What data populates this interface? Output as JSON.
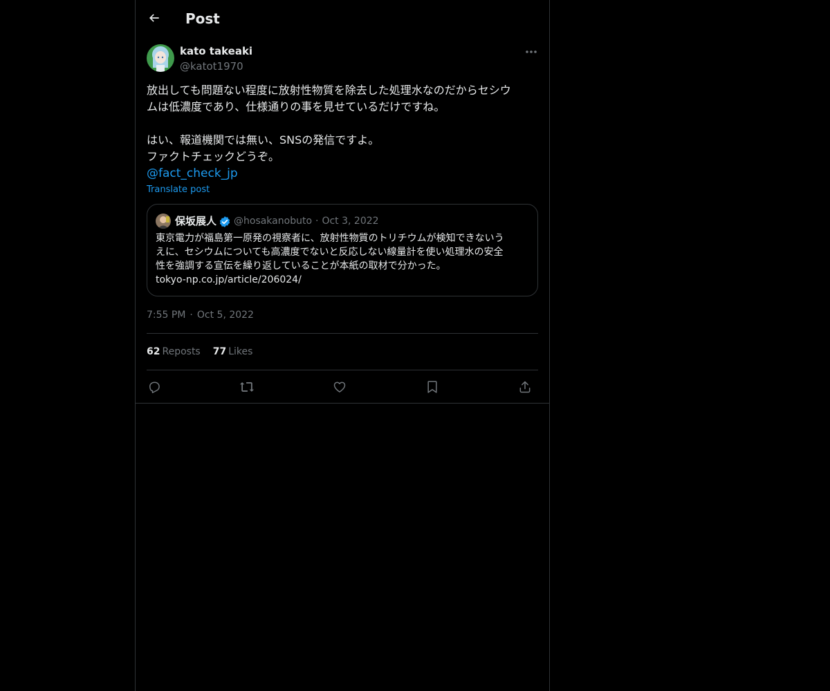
{
  "header": {
    "title": "Post",
    "back_icon": "arrow-left-icon"
  },
  "post": {
    "author": {
      "name": "kato takeaki",
      "handle": "@katot1970",
      "avatar_icon": "anime-character-avatar"
    },
    "more_icon": "ellipsis-icon",
    "text_lines": [
      "放出しても問題ない程度に放射性物質を除去した処理水なのだからセシウ",
      "ムは低濃度であり、仕様通りの事を見せているだけですね。",
      "",
      "はい、報道機関では無い、SNSの発信ですよ。",
      "ファクトチェックどうぞ。"
    ],
    "mention": "@fact_check_jp",
    "translate_label": "Translate post",
    "quote": {
      "name": "保坂展人",
      "handle": "@hosakanobuto",
      "separator": "·",
      "date": "Oct 3, 2022",
      "verified_icon": "verified-badge-icon",
      "text_lines": [
        "東京電力が福島第一原発の視察者に、放射性物質のトリチウムが検知できないう",
        "えに、セシウムについても高濃度でないと反応しない線量計を使い処理水の安全",
        "性を強調する宣伝を繰り返していることが本紙の取材で分かった。",
        "tokyo-np.co.jp/article/206024/"
      ]
    },
    "time": "7:55 PM",
    "time_separator": "·",
    "date": "Oct 5, 2022",
    "stats": {
      "reposts_count": "62",
      "reposts_label": "Reposts",
      "likes_count": "77",
      "likes_label": "Likes"
    },
    "actions": [
      {
        "name": "reply-button",
        "icon": "reply-icon"
      },
      {
        "name": "repost-button",
        "icon": "repost-icon"
      },
      {
        "name": "like-button",
        "icon": "heart-icon"
      },
      {
        "name": "bookmark-button",
        "icon": "bookmark-icon"
      },
      {
        "name": "share-button",
        "icon": "share-icon"
      }
    ]
  },
  "colors": {
    "background": "#000000",
    "text": "#e7e9ea",
    "secondary_text": "#71767b",
    "link": "#1d9bf0",
    "border": "#2f3336",
    "verified": "#1d9bf0"
  }
}
